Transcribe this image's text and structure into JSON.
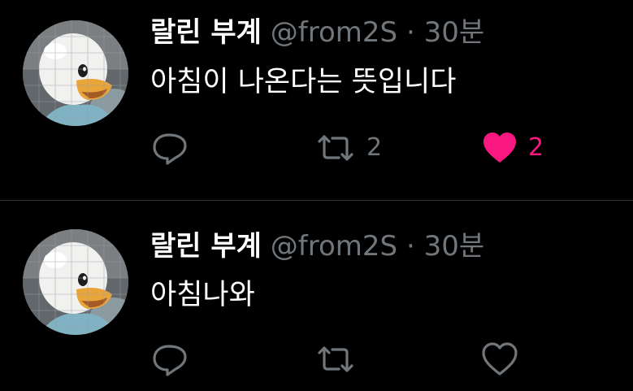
{
  "colors": {
    "background": "#000000",
    "text_primary": "#ffffff",
    "text_secondary": "#71767b",
    "like_active": "#f91880",
    "divider": "#2f3336"
  },
  "tweets": [
    {
      "display_name": "랄린 부계",
      "handle": "@from2S",
      "separator": "·",
      "time": "30분",
      "text": "아침이 나온다는 뜻입니다",
      "reply_icon": "speech-bubble-icon",
      "retweet_icon": "retweet-icon",
      "retweet_count": "2",
      "like_icon": "heart-filled-icon",
      "like_count": "2",
      "liked": true
    },
    {
      "display_name": "랄린 부계",
      "handle": "@from2S",
      "separator": "·",
      "time": "30분",
      "text": "아침나와",
      "reply_icon": "speech-bubble-icon",
      "retweet_icon": "retweet-icon",
      "retweet_count": "",
      "like_icon": "heart-outline-icon",
      "like_count": "",
      "liked": false
    }
  ]
}
